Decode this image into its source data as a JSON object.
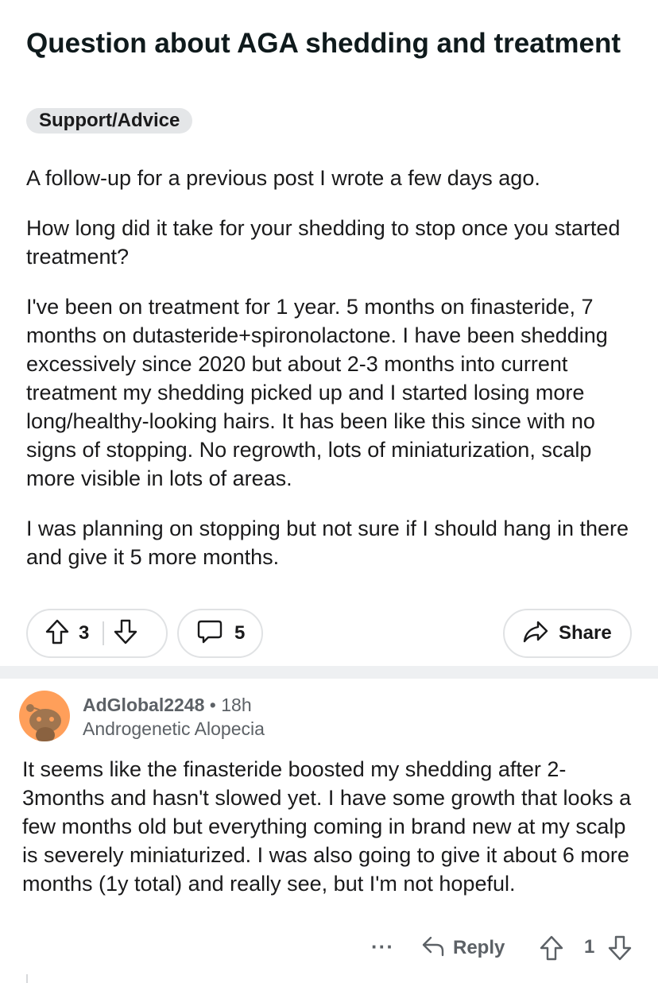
{
  "post": {
    "title": "Question about AGA shedding and treatment",
    "flair": "Support/Advice",
    "paragraphs": [
      "A follow-up for a previous post I wrote a few days ago.",
      "How long did it take for your shedding to stop once you started treatment?",
      "I've been on treatment for 1 year. 5 months on finasteride, 7 months on dutasteride+spironolactone. I have been shedding excessively since 2020 but about 2-3 months into current treatment my shedding picked up and I started losing more long/healthy-looking hairs. It has been like this since with no signs of stopping. No regrowth, lots of miniaturization, scalp more visible in lots of areas.",
      "I was planning on stopping but not sure if I should hang in there and give it 5 more months."
    ],
    "votes": "3",
    "comments": "5",
    "share_label": "Share"
  },
  "comment": {
    "author": "AdGlobal2248",
    "separator": "•",
    "time": "18h",
    "user_flair": "Androgenetic Alopecia",
    "body": "It seems like the finasteride boosted my shedding after 2-3months and hasn't slowed yet. I have some growth that looks a few months old but everything coming in brand new at my scalp is severely miniaturized. I was also going to give it about 6 more months (1y total) and really see, but I'm not hopeful.",
    "more_label": "···",
    "reply_label": "Reply",
    "votes": "1"
  },
  "icons": {
    "upvote": "upvote-arrow-icon",
    "downvote": "downvote-arrow-icon",
    "comment": "comment-bubble-icon",
    "share": "share-arrow-icon",
    "reply": "reply-arrow-icon",
    "avatar": "snoo-avatar-icon"
  },
  "colors": {
    "avatar_bg": "#ff9f5a",
    "flair_bg": "#e4e6e8",
    "meta_text": "#5c6166"
  }
}
